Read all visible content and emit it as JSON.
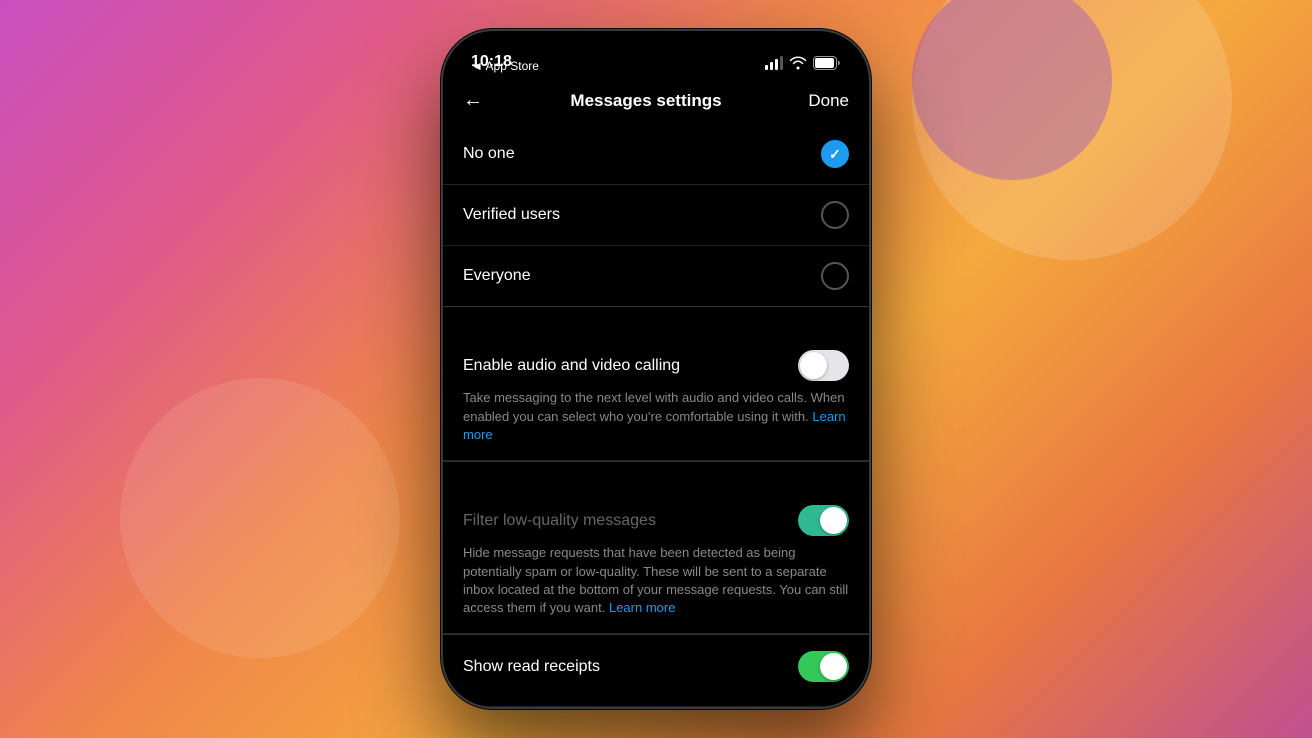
{
  "background": {
    "gradient": "linear-gradient(135deg, #c94fc0 0%, #e0598a 20%, #f0864a 40%, #f5a93e 60%, #e87840 80%, #c05090 100%)"
  },
  "statusBar": {
    "time": "10:18",
    "backLabel": "◄ App Store"
  },
  "navBar": {
    "backIcon": "←",
    "title": "Messages settings",
    "doneLabel": "Done"
  },
  "sections": {
    "messageRequests": {
      "options": [
        {
          "id": "no-one",
          "label": "No one",
          "selected": true
        },
        {
          "id": "verified-users",
          "label": "Verified users",
          "selected": false
        },
        {
          "id": "everyone",
          "label": "Everyone",
          "selected": false
        }
      ]
    },
    "audioVideo": {
      "label": "Enable audio and video calling",
      "toggleState": "off-white",
      "description": "Take messaging to the next level with audio and video calls. When enabled you can select who you're comfortable using it with.",
      "learnMore": "Learn more"
    },
    "filterLowQuality": {
      "label": "Filter low-quality messages",
      "toggleState": "on-teal",
      "description": "Hide message requests that have been detected as being potentially spam or low-quality. These will be sent to a separate inbox located at the bottom of your message requests. You can still access them if you want.",
      "learnMore": "Learn more"
    },
    "readReceipts": {
      "label": "Show read receipts",
      "toggleState": "on-green"
    }
  }
}
